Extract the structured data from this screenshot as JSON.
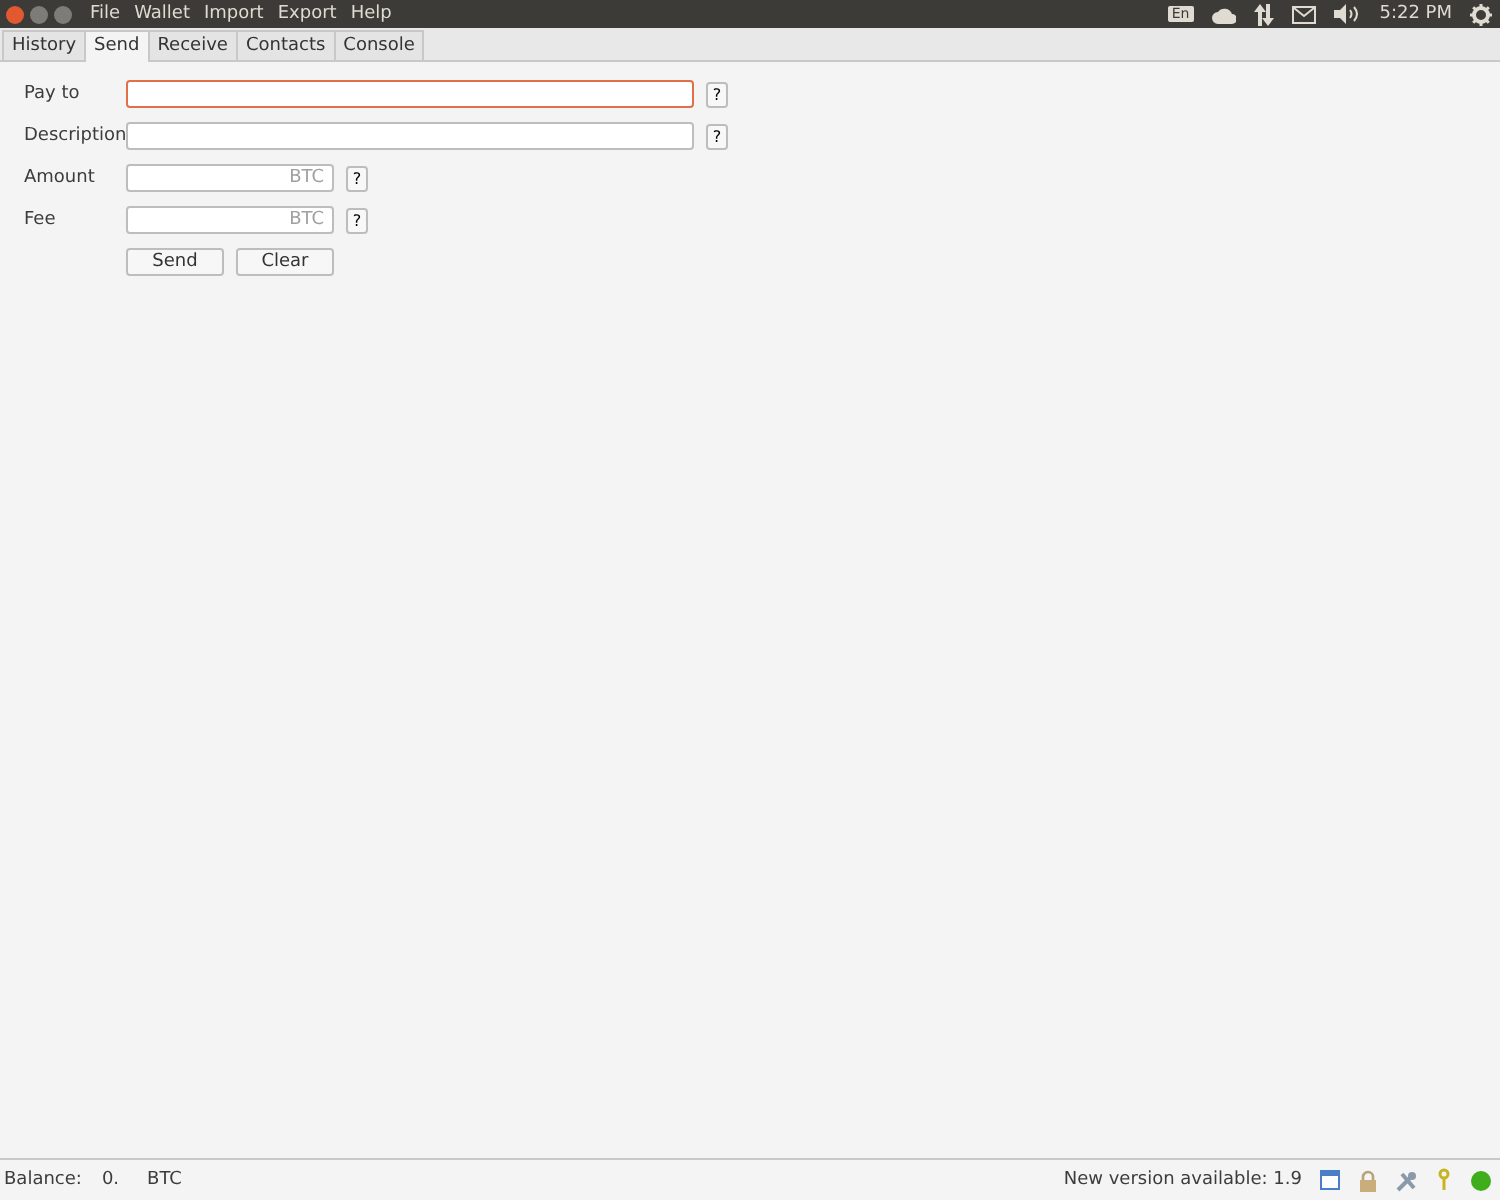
{
  "menu_bar": {
    "items": [
      "File",
      "Wallet",
      "Import",
      "Export",
      "Help"
    ],
    "tray": {
      "keyboard": "En",
      "time": "5:22 PM"
    }
  },
  "tabs": [
    {
      "label": "History",
      "selected": false
    },
    {
      "label": "Send",
      "selected": true
    },
    {
      "label": "Receive",
      "selected": false
    },
    {
      "label": "Contacts",
      "selected": false
    },
    {
      "label": "Console",
      "selected": false
    }
  ],
  "form": {
    "fields": [
      {
        "label": "Pay to",
        "kind": "wide",
        "focused": true,
        "help": "?"
      },
      {
        "label": "Description",
        "kind": "wide",
        "focused": false,
        "help": "?"
      },
      {
        "label": "Amount",
        "kind": "amount",
        "focused": false,
        "placeholder": "BTC",
        "help": "?"
      },
      {
        "label": "Fee",
        "kind": "amount",
        "focused": false,
        "placeholder": "BTC",
        "help": "?"
      }
    ],
    "buttons": [
      "Send",
      "Clear"
    ]
  },
  "status_bar": {
    "balance_label": "Balance:",
    "balance_value": "0.",
    "balance_unit": "BTC",
    "version_notice": "New version available: 1.9",
    "connected": true
  }
}
